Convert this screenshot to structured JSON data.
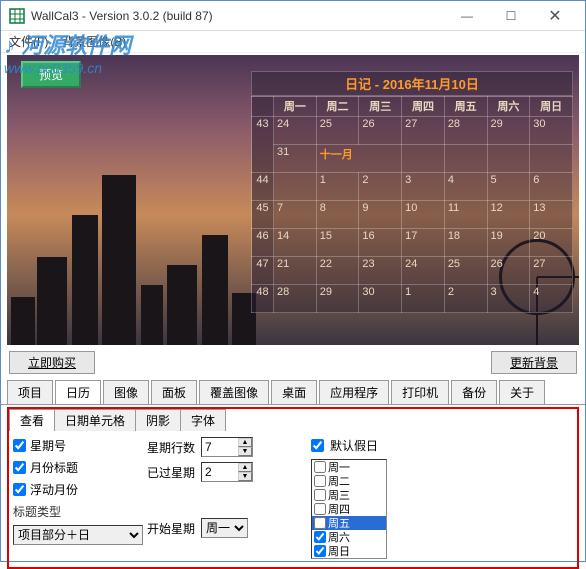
{
  "window": {
    "title": "WallCal3 - Version 3.0.2 (build 87)"
  },
  "watermark": {
    "line1": "♪ 河源软件网",
    "line2": "www.pc0359.cn"
  },
  "menu": {
    "file": "文件(F)",
    "bgimage": "背景图像(B)"
  },
  "preview": {
    "btn": "预览"
  },
  "calendar": {
    "title": "日记 - 2016年11月10日",
    "days": [
      "周一",
      "周二",
      "周三",
      "周四",
      "周五",
      "周六",
      "周日"
    ],
    "month_label": "十一月",
    "weeks": [
      {
        "wk": "43",
        "cells": [
          "24",
          "25",
          "26",
          "27",
          "28",
          "29",
          "30"
        ]
      },
      {
        "wk": "",
        "cells": [
          "31",
          "",
          "",
          "",
          "",
          "",
          ""
        ]
      },
      {
        "wk": "44",
        "cells": [
          "",
          "1",
          "2",
          "3",
          "4",
          "5",
          "6"
        ]
      },
      {
        "wk": "45",
        "cells": [
          "7",
          "8",
          "9",
          "10",
          "11",
          "12",
          "13"
        ]
      },
      {
        "wk": "46",
        "cells": [
          "14",
          "15",
          "16",
          "17",
          "18",
          "19",
          "20"
        ]
      },
      {
        "wk": "47",
        "cells": [
          "21",
          "22",
          "23",
          "24",
          "25",
          "26",
          "27"
        ]
      },
      {
        "wk": "48",
        "cells": [
          "28",
          "29",
          "30",
          "1",
          "2",
          "3",
          "4"
        ]
      }
    ]
  },
  "buttons": {
    "buy": "立即购买",
    "update_bg": "更新背景"
  },
  "maintabs": [
    "项目",
    "日历",
    "图像",
    "面板",
    "覆盖图像",
    "桌面",
    "应用程序",
    "打印机",
    "备份",
    "关于"
  ],
  "subtabs": [
    "查看",
    "日期单元格",
    "阴影",
    "字体"
  ],
  "settings": {
    "week_num": "星期号",
    "month_title": "月份标题",
    "float_month": "浮动月份",
    "title_type_label": "标题类型",
    "title_type_value": "项目部分＋日",
    "week_rows_label": "星期行数",
    "week_rows_value": "7",
    "past_weeks_label": "已过星期",
    "past_weeks_value": "2",
    "start_week_label": "开始星期",
    "start_week_value": "周一",
    "default_holiday_label": "默认假日",
    "daylist": [
      {
        "label": "周一",
        "checked": false,
        "sel": false
      },
      {
        "label": "周二",
        "checked": false,
        "sel": false
      },
      {
        "label": "周三",
        "checked": false,
        "sel": false
      },
      {
        "label": "周四",
        "checked": false,
        "sel": false
      },
      {
        "label": "周五",
        "checked": false,
        "sel": true
      },
      {
        "label": "周六",
        "checked": true,
        "sel": false
      },
      {
        "label": "周日",
        "checked": true,
        "sel": false
      }
    ]
  }
}
